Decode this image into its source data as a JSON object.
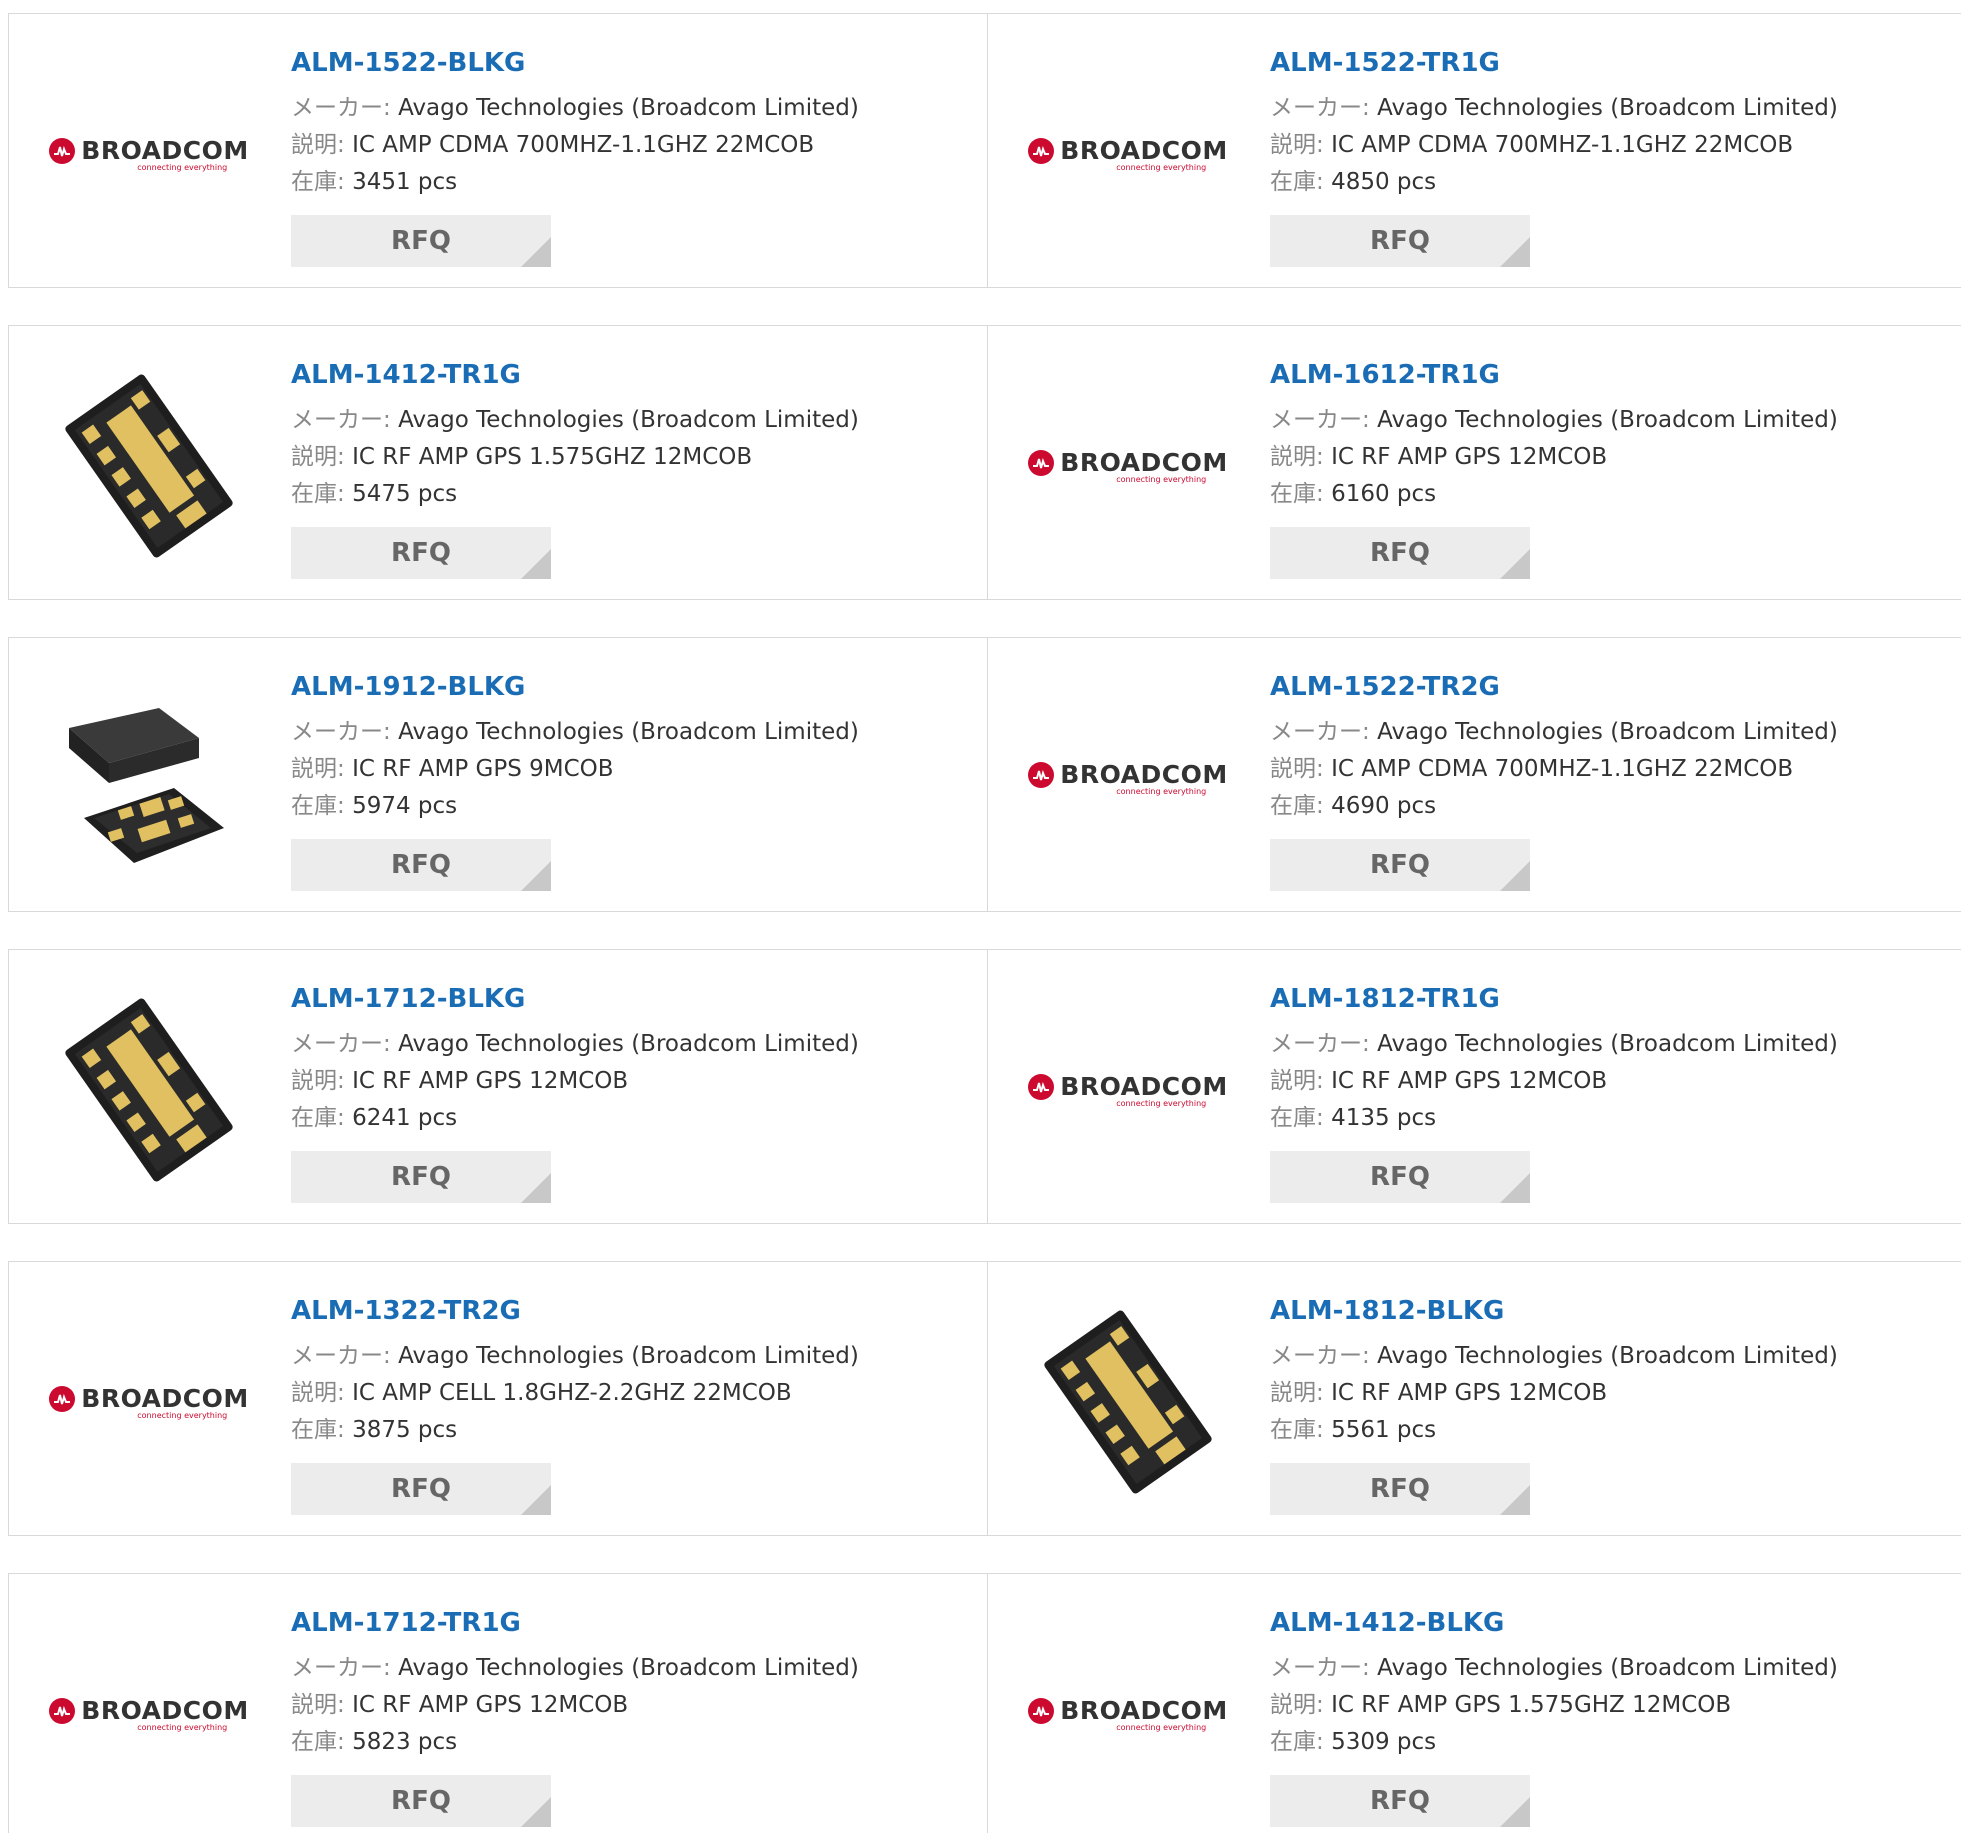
{
  "labels": {
    "maker": "メーカー:",
    "description": "説明:",
    "stock": "在庫:",
    "rfq": "RFQ"
  },
  "logo": {
    "brand": "BROADCOM",
    "tagline": "connecting everything"
  },
  "colors": {
    "title": "#1a6db5",
    "rfq_bg": "#ececec",
    "broadcom_red": "#cc092f"
  },
  "products": [
    {
      "part": "ALM-1522-BLKG",
      "maker": "Avago Technologies (Broadcom Limited)",
      "description": "IC AMP CDMA 700MHZ-1.1GHZ 22MCOB",
      "stock": "3451 pcs",
      "image": "broadcom-logo"
    },
    {
      "part": "ALM-1522-TR1G",
      "maker": "Avago Technologies (Broadcom Limited)",
      "description": "IC AMP CDMA 700MHZ-1.1GHZ 22MCOB",
      "stock": "4850 pcs",
      "image": "broadcom-logo"
    },
    {
      "part": "ALM-1412-TR1G",
      "maker": "Avago Technologies (Broadcom Limited)",
      "description": "IC RF AMP GPS 1.575GHZ 12MCOB",
      "stock": "5475 pcs",
      "image": "chip-photo"
    },
    {
      "part": "ALM-1612-TR1G",
      "maker": "Avago Technologies (Broadcom Limited)",
      "description": "IC RF AMP GPS 12MCOB",
      "stock": "6160 pcs",
      "image": "broadcom-logo"
    },
    {
      "part": "ALM-1912-BLKG",
      "maker": "Avago Technologies (Broadcom Limited)",
      "description": "IC RF AMP GPS 9MCOB",
      "stock": "5974 pcs",
      "image": "chip-photo-lid"
    },
    {
      "part": "ALM-1522-TR2G",
      "maker": "Avago Technologies (Broadcom Limited)",
      "description": "IC AMP CDMA 700MHZ-1.1GHZ 22MCOB",
      "stock": "4690 pcs",
      "image": "broadcom-logo"
    },
    {
      "part": "ALM-1712-BLKG",
      "maker": "Avago Technologies (Broadcom Limited)",
      "description": "IC RF AMP GPS 12MCOB",
      "stock": "6241 pcs",
      "image": "chip-photo"
    },
    {
      "part": "ALM-1812-TR1G",
      "maker": "Avago Technologies (Broadcom Limited)",
      "description": "IC RF AMP GPS 12MCOB",
      "stock": "4135 pcs",
      "image": "broadcom-logo"
    },
    {
      "part": "ALM-1322-TR2G",
      "maker": "Avago Technologies (Broadcom Limited)",
      "description": "IC AMP CELL 1.8GHZ-2.2GHZ 22MCOB",
      "stock": "3875 pcs",
      "image": "broadcom-logo"
    },
    {
      "part": "ALM-1812-BLKG",
      "maker": "Avago Technologies (Broadcom Limited)",
      "description": "IC RF AMP GPS 12MCOB",
      "stock": "5561 pcs",
      "image": "chip-photo"
    },
    {
      "part": "ALM-1712-TR1G",
      "maker": "Avago Technologies (Broadcom Limited)",
      "description": "IC RF AMP GPS 12MCOB",
      "stock": "5823 pcs",
      "image": "broadcom-logo"
    },
    {
      "part": "ALM-1412-BLKG",
      "maker": "Avago Technologies (Broadcom Limited)",
      "description": "IC RF AMP GPS 1.575GHZ 12MCOB",
      "stock": "5309 pcs",
      "image": "broadcom-logo"
    }
  ]
}
